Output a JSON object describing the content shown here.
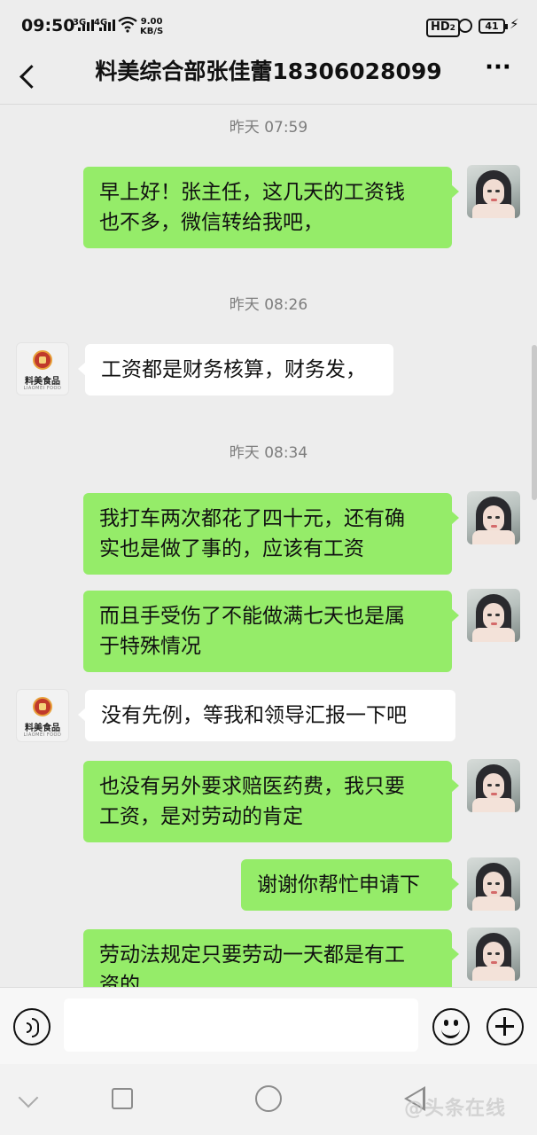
{
  "status_bar": {
    "time": "09:50",
    "signal_1": "3G",
    "signal_2": "4G",
    "net_speed_value": "9.00",
    "net_speed_unit": "KB/S",
    "hd_label": "HD",
    "hd_sub": "2",
    "battery": "41"
  },
  "header": {
    "title": "料美综合部张佳蕾18306028099",
    "more_label": "···"
  },
  "chat": {
    "timestamps": [
      "昨天 07:59",
      "昨天 08:26",
      "昨天 08:34"
    ],
    "messages": [
      {
        "side": "right",
        "line1": "早上好！张主任，这几天的工资钱",
        "line2": "也不多，微信转给我吧，"
      },
      {
        "side": "left",
        "line1": "工资都是财务核算，财务发，"
      },
      {
        "side": "right",
        "line1": "我打车两次都花了四十元，还有确",
        "line2": "实也是做了事的，应该有工资"
      },
      {
        "side": "right",
        "line1": "而且手受伤了不能做满七天也是属",
        "line2": "于特殊情况"
      },
      {
        "side": "left",
        "line1": "没有先例，等我和领导汇报一下吧"
      },
      {
        "side": "right",
        "line1": "也没有另外要求赔医药费，我只要",
        "line2": "工资，是对劳动的肯定"
      },
      {
        "side": "right",
        "line1": "谢谢你帮忙申请下"
      },
      {
        "side": "right",
        "line1": "劳动法规定只要劳动一天都是有工",
        "line2": "资的"
      }
    ],
    "company_avatar": {
      "name": "料美食品",
      "sub": "LIAOMEI FOOD"
    }
  },
  "input_bar": {
    "message_value": ""
  },
  "watermark": "@头条在线",
  "colors": {
    "sent_bubble": "#95ec69",
    "received_bubble": "#ffffff",
    "background": "#ededed"
  }
}
